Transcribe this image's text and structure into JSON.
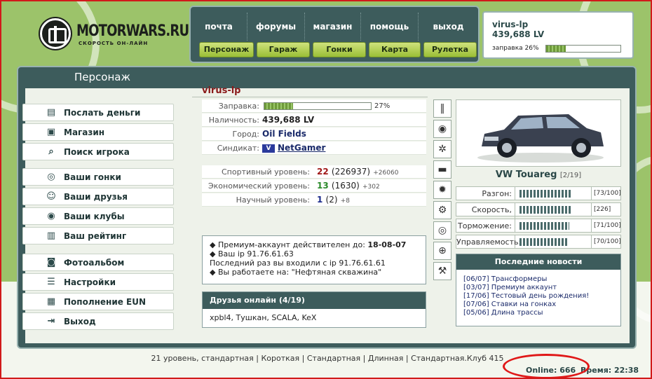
{
  "logo": {
    "name": "MOTORWARS.RU",
    "tagline": "СКОРОСТЬ ОН-ЛАЙН"
  },
  "nav": {
    "top": [
      "почта",
      "форумы",
      "магазин",
      "помощь",
      "выход"
    ],
    "buttons": [
      "Персонаж",
      "Гараж",
      "Гонки",
      "Карта",
      "Рулетка"
    ]
  },
  "user": {
    "name": "virus-lp",
    "money": "439,688 LV",
    "fuel_label": "заправка 26%",
    "fuel_fraction": 0.26
  },
  "section": {
    "title": "Персонаж"
  },
  "menu": {
    "group1": [
      {
        "label": "Послать деньги",
        "icon": "money-icon"
      },
      {
        "label": "Магазин",
        "icon": "shop-icon"
      },
      {
        "label": "Поиск игрока",
        "icon": "search-icon"
      }
    ],
    "group2": [
      {
        "label": "Ваши гонки",
        "icon": "steering-wheel-icon"
      },
      {
        "label": "Ваши друзья",
        "icon": "friends-icon"
      },
      {
        "label": "Ваши клубы",
        "icon": "clubs-icon"
      },
      {
        "label": "Ваш рейтинг",
        "icon": "rating-icon"
      }
    ],
    "group3": [
      {
        "label": "Фотоальбом",
        "icon": "camera-icon"
      },
      {
        "label": "Настройки",
        "icon": "settings-icon"
      },
      {
        "label": "Пополнение EUN",
        "icon": "topup-icon"
      },
      {
        "label": "Выход",
        "icon": "exit-icon"
      }
    ]
  },
  "character": {
    "name": "virus-lp",
    "fuel_label": "Заправка:",
    "fuel_fraction": 0.27,
    "fuel_pct": "27%",
    "cash_label": "Наличность:",
    "cash": "439,688 LV",
    "city_label": "Город:",
    "city": "Oil Fields",
    "syndicate_label": "Синдикат:",
    "syndicate": "NetGamer",
    "syndicate_badge": "V",
    "sport_label": "Спортивный уровень:",
    "sport_level": "22",
    "sport_points": "(226937)",
    "sport_delta": "+26060",
    "econ_label": "Экономический уровень:",
    "econ_level": "13",
    "econ_points": "(1630)",
    "econ_delta": "+302",
    "sci_label": "Научный уровень:",
    "sci_level": "1",
    "sci_points": "(2)",
    "sci_delta": "+8"
  },
  "info": {
    "premium_text": "Премиум-аккаунт действителен до:",
    "premium_date": "18-08-07",
    "ip_line": "Ваш ip 91.76.61.63",
    "last_login": "Последний раз вы входили с ip 91.76.61.61",
    "work_line": "Вы работаете на: \"Нефтяная скважина\""
  },
  "friends": {
    "title": "Друзья онлайн (4/19)",
    "list": "xpbl4, Тушкан, SCALA, KeX"
  },
  "car": {
    "name": "VW Touareg",
    "slot": "[2/19]",
    "stats": [
      {
        "label": "Разгон:",
        "value": "[73/100]",
        "fraction": 0.73
      },
      {
        "label": "Скорость, км/ч:",
        "value": "[226]",
        "fraction": 0.74
      },
      {
        "label": "Торможение:",
        "value": "[71/100]",
        "fraction": 0.71
      },
      {
        "label": "Управляемость:",
        "value": "[70/100]",
        "fraction": 0.7
      }
    ]
  },
  "news": {
    "title": "Последние новости",
    "items": [
      "[06/07] Трансформеры",
      "[03/07] Премиум аккаунт",
      "[17/06] Тестовый день рождения!",
      "[07/06] Ставки на гонках",
      "[05/06] Длина трассы"
    ]
  },
  "footer": {
    "links": "21 уровень, стандартная | Короткая | Стандартная | Длинная | Стандартная.Клуб 415",
    "online": "Online: 666",
    "time": "Время: 22:38"
  },
  "colors": {
    "accent": "#3d5c5c",
    "green": "#9cc36a",
    "highlight": "#e01818"
  }
}
